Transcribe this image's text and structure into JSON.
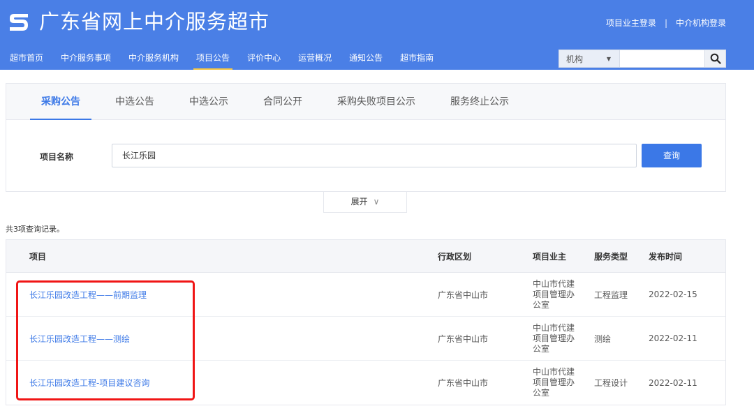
{
  "header": {
    "title": "广东省网上中介服务超市",
    "links": {
      "owner_login": "项目业主登录",
      "separator": "|",
      "agency_login": "中介机构登录"
    },
    "nav": [
      "超市首页",
      "中介服务事项",
      "中介服务机构",
      "项目公告",
      "评价中心",
      "运营概况",
      "通知公告",
      "超市指南"
    ],
    "active_nav": "项目公告",
    "search": {
      "category": "机构",
      "value": ""
    }
  },
  "filter": {
    "tabs": [
      "采购公告",
      "中选公告",
      "中选公示",
      "合同公开",
      "采购失败项目公示",
      "服务终止公示"
    ],
    "active_tab": "采购公告",
    "field_label": "项目名称",
    "field_value": "长江乐园",
    "query_label": "查询",
    "expand_label": "展开"
  },
  "results": {
    "count_text": "共3项查询记录。",
    "columns": [
      "项目",
      "行政区划",
      "项目业主",
      "服务类型",
      "发布时间"
    ],
    "rows": [
      {
        "project": "长江乐园改造工程——前期监理",
        "area": "广东省中山市",
        "owner": "中山市代建项目管理办公室",
        "type": "工程监理",
        "date": "2022-02-15"
      },
      {
        "project": "长江乐园改造工程——测绘",
        "area": "广东省中山市",
        "owner": "中山市代建项目管理办公室",
        "type": "测绘",
        "date": "2022-02-11"
      },
      {
        "project": "长江乐园改造工程-项目建议咨询",
        "area": "广东省中山市",
        "owner": "中山市代建项目管理办公室",
        "type": "工程设计",
        "date": "2022-02-11"
      }
    ]
  },
  "colors": {
    "header_bg": "#4a7fe6",
    "accent": "#3b78e7",
    "highlight": "#f01515"
  }
}
